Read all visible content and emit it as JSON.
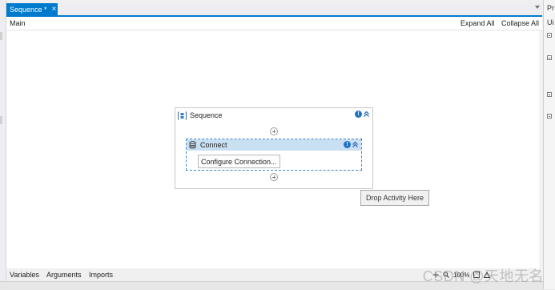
{
  "document_tab": {
    "title": "Sequence *",
    "close_glyph": "×"
  },
  "header": {
    "breadcrumb": "Main",
    "expand_all": "Expand All",
    "collapse_all": "Collapse All"
  },
  "sequence": {
    "title": "Sequence",
    "icon": "sequence-icon",
    "badge": "!",
    "connect": {
      "title": "Connect",
      "icon": "database-icon",
      "badge": "!",
      "configure_button": "Configure Connection..."
    }
  },
  "drop_hint": "Drop Activity Here",
  "bottom_tabs": {
    "variables": "Variables",
    "arguments": "Arguments",
    "imports": "Imports"
  },
  "status": {
    "zoom": "100%"
  },
  "properties_panel": {
    "tab": "Pr",
    "label": "Ui"
  },
  "watermark": "CSDN @天地无名",
  "colors": {
    "accent": "#007acc",
    "activity_header": "#c9dff2",
    "info_badge": "#1f73c6"
  }
}
